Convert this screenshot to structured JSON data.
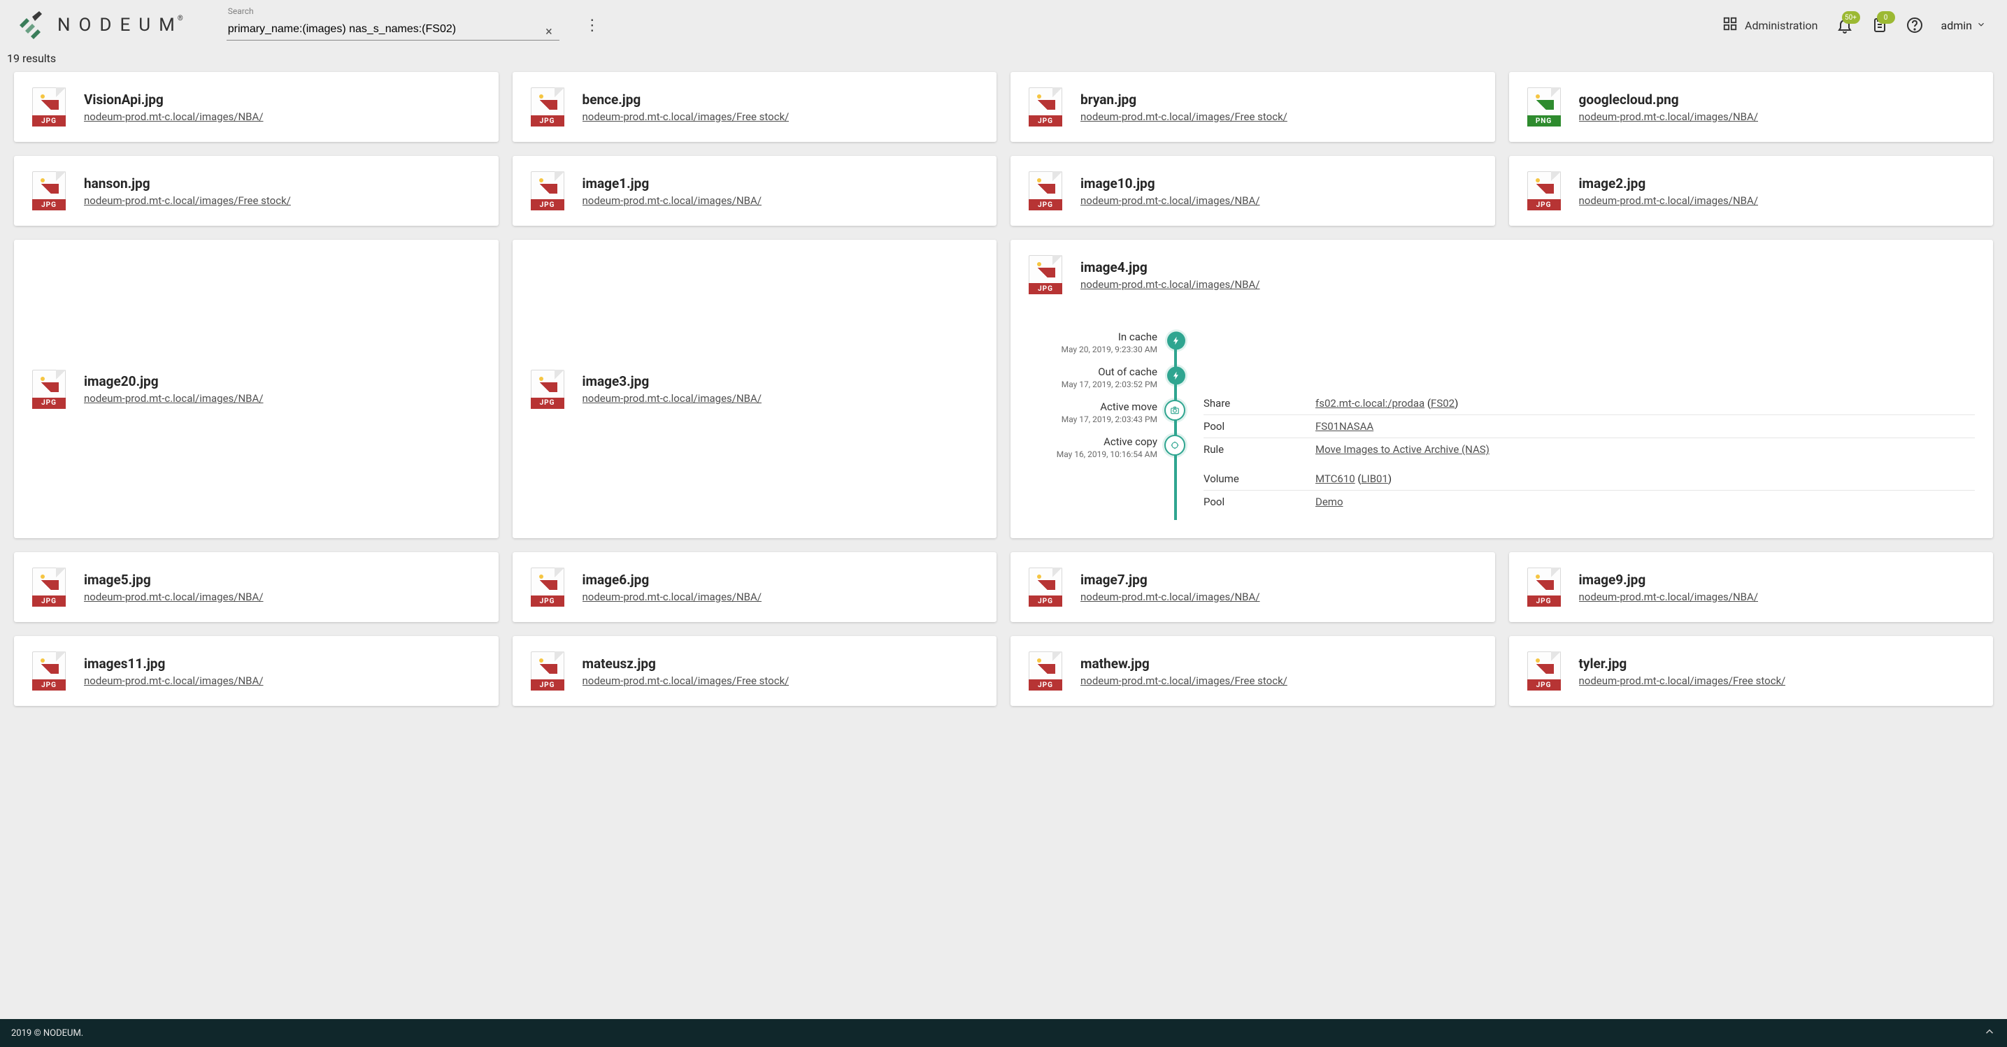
{
  "brand": "NODEUM",
  "search": {
    "label": "Search",
    "value": "primary_name:(images) nas_s_names:(FS02)"
  },
  "nav": {
    "administration": "Administration",
    "user": "admin"
  },
  "badges": {
    "bell": "50+",
    "clipboard": "0"
  },
  "results_text": "19 results",
  "path_nba": "nodeum-prod.mt-c.local/images/NBA/",
  "path_free": "nodeum-prod.mt-c.local/images/Free stock/",
  "files": [
    {
      "name": "VisionApi.jpg",
      "path": "nba",
      "type": "jpg"
    },
    {
      "name": "bence.jpg",
      "path": "free",
      "type": "jpg"
    },
    {
      "name": "bryan.jpg",
      "path": "free",
      "type": "jpg"
    },
    {
      "name": "googlecloud.png",
      "path": "nba",
      "type": "png"
    },
    {
      "name": "hanson.jpg",
      "path": "free",
      "type": "jpg"
    },
    {
      "name": "image1.jpg",
      "path": "nba",
      "type": "jpg"
    },
    {
      "name": "image10.jpg",
      "path": "nba",
      "type": "jpg"
    },
    {
      "name": "image2.jpg",
      "path": "nba",
      "type": "jpg"
    },
    {
      "name": "image20.jpg",
      "path": "nba",
      "type": "jpg"
    },
    {
      "name": "image3.jpg",
      "path": "nba",
      "type": "jpg"
    },
    {
      "name": "image5.jpg",
      "path": "nba",
      "type": "jpg"
    },
    {
      "name": "image6.jpg",
      "path": "nba",
      "type": "jpg"
    },
    {
      "name": "image7.jpg",
      "path": "nba",
      "type": "jpg"
    },
    {
      "name": "image9.jpg",
      "path": "nba",
      "type": "jpg"
    },
    {
      "name": "images11.jpg",
      "path": "nba",
      "type": "jpg"
    },
    {
      "name": "mateusz.jpg",
      "path": "free",
      "type": "jpg"
    },
    {
      "name": "mathew.jpg",
      "path": "free",
      "type": "jpg"
    },
    {
      "name": "tyler.jpg",
      "path": "free",
      "type": "jpg"
    }
  ],
  "expanded": {
    "name": "image4.jpg",
    "path": "nba",
    "type": "jpg",
    "timeline": [
      {
        "label": "In cache",
        "date": "May 20, 2019, 9:23:30 AM",
        "icon": "bolt",
        "style": "fill"
      },
      {
        "label": "Out of cache",
        "date": "May 17, 2019, 2:03:52 PM",
        "icon": "bolt",
        "style": "fill"
      },
      {
        "label": "Active move",
        "date": "May 17, 2019, 2:03:43 PM",
        "icon": "camera",
        "style": "outline"
      },
      {
        "label": "Active copy",
        "date": "May 16, 2019, 10:16:54 AM",
        "icon": "gear",
        "style": "outline"
      }
    ],
    "details_move": [
      {
        "key": "Share",
        "value_html": "<a href='#'>fs02.mt-c.local:/prodaa</a> (<a href='#'>FS02</a>)"
      },
      {
        "key": "Pool",
        "value_html": "<a href='#'>FS01NASAA</a>"
      },
      {
        "key": "Rule",
        "value_html": "<a href='#'>Move Images to Active Archive (NAS)</a>"
      }
    ],
    "details_copy": [
      {
        "key": "Volume",
        "value_html": "<a href='#'>MTC610</a> (<a href='#'>LIB01</a>)"
      },
      {
        "key": "Pool",
        "value_html": "<a href='#'>Demo</a>"
      }
    ]
  },
  "footer": "2019 © NODEUM."
}
